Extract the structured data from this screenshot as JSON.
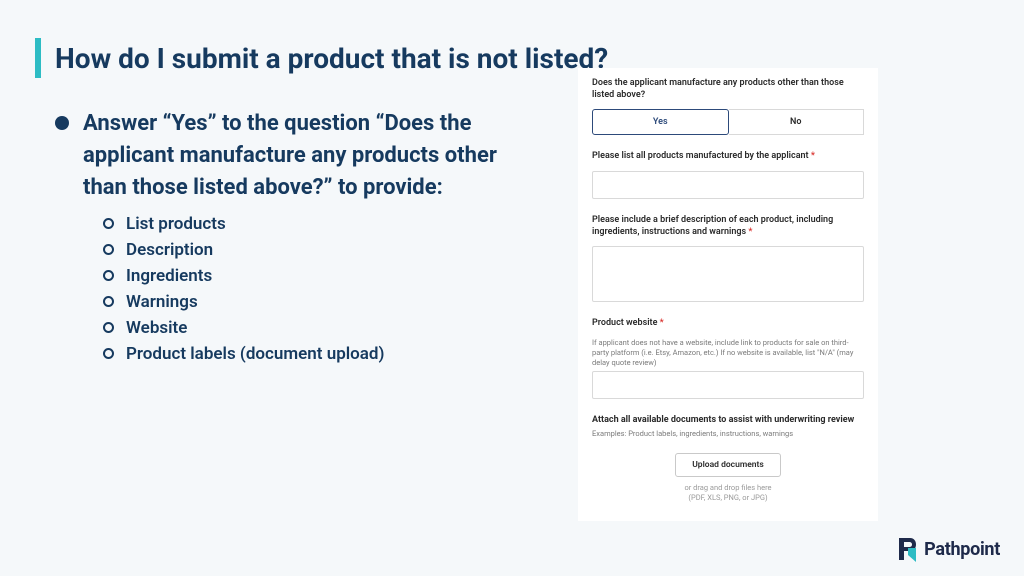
{
  "title": "How do I submit a product that is not listed?",
  "main_bullet": "Answer “Yes” to the question “Does the applicant manufacture any products other than those listed above?” to provide:",
  "sub_items": [
    "List products",
    "Description",
    "Ingredients",
    "Warnings",
    "Website",
    "Product labels (document upload)"
  ],
  "form": {
    "q1": "Does the applicant manufacture any products other than those listed above?",
    "yes": "Yes",
    "no": "No",
    "q2": "Please list all products manufactured by the applicant",
    "q3": "Please include a brief description of each product, including ingredients, instructions and warnings",
    "q4": "Product website",
    "q4_helper": "If applicant does not have a website, include link to products for sale on third-party platform (i.e. Etsy, Amazon, etc.) If no website is available, list \"N/A\" (may delay quote review)",
    "attach_heading": "Attach all available documents to assist with underwriting review",
    "attach_examples": "Examples: Product labels, ingredients, instructions, warnings",
    "upload_btn": "Upload documents",
    "upload_sub1": "or drag and drop files here",
    "upload_sub2": "(PDF, XLS, PNG, or JPG)"
  },
  "brand": "Pathpoint"
}
